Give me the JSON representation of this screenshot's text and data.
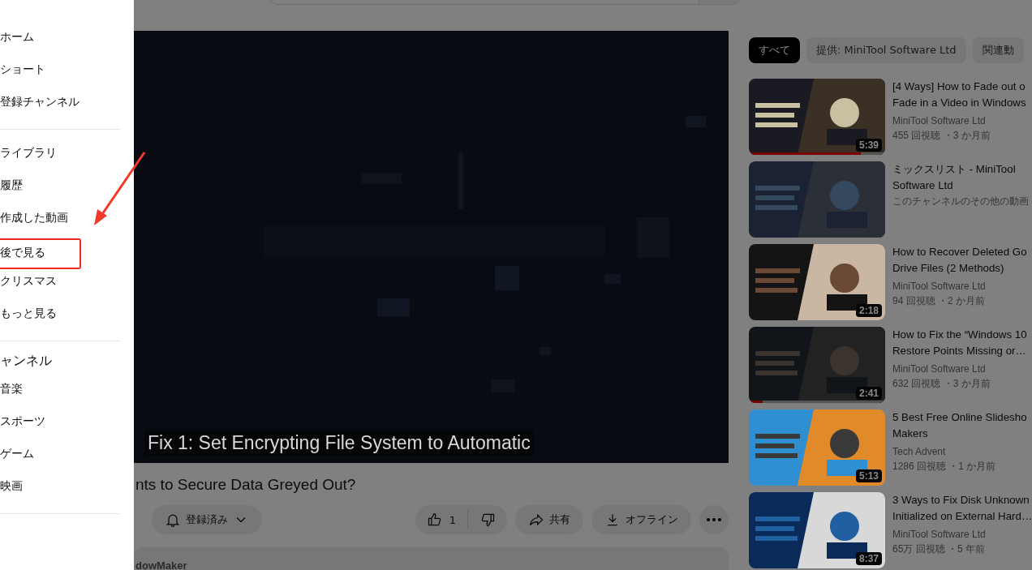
{
  "sidebar": {
    "sections": [
      {
        "items": [
          {
            "label": "ホーム",
            "highlighted": false
          },
          {
            "label": "ショート",
            "highlighted": false
          },
          {
            "label": "登録チャンネル",
            "highlighted": false
          }
        ]
      },
      {
        "items": [
          {
            "label": "ライブラリ",
            "highlighted": false
          },
          {
            "label": "履歴",
            "highlighted": false
          },
          {
            "label": "作成した動画",
            "highlighted": false
          },
          {
            "label": "後で見る",
            "highlighted": true
          },
          {
            "label": "クリスマス",
            "highlighted": false
          },
          {
            "label": "もっと見る",
            "highlighted": false
          }
        ]
      },
      {
        "heading": "ャンネル",
        "items": [
          {
            "label": "音楽",
            "highlighted": false
          },
          {
            "label": "スポーツ",
            "highlighted": false
          },
          {
            "label": "ゲーム",
            "highlighted": false
          },
          {
            "label": "映画",
            "highlighted": false
          }
        ]
      }
    ]
  },
  "player": {
    "caption": "Fix 1: Set Encrypting File System to Automatic"
  },
  "video": {
    "title": "nts to Secure Data Greyed Out?",
    "subscribe": "登録済み",
    "likes": "1",
    "share": "共有",
    "download": "オフライン",
    "description": "dowMaker"
  },
  "chips": [
    {
      "label": "すべて",
      "selected": true
    },
    {
      "label": "提供: MiniTool Software Ltd",
      "selected": false
    },
    {
      "label": "関連動",
      "selected": false
    }
  ],
  "recommendations": [
    {
      "title_lines": [
        "[4 Ways] How to Fade out o",
        "Fade in a Video in Windows"
      ],
      "channel": "MiniTool Software Ltd",
      "meta": "455 回視聴 ・3 か月前",
      "duration": "5:39",
      "level": 0.82
    },
    {
      "title_lines": [
        "ミックスリスト - MiniTool",
        "Software Ltd"
      ],
      "meta": "このチャンネルのその他の動画"
    },
    {
      "title_lines": [
        "How to Recover Deleted Go",
        "Drive Files (2 Methods)"
      ],
      "channel": "MiniTool Software Ltd",
      "meta": "94 回視聴 ・2 か月前",
      "duration": "2:18"
    },
    {
      "title_lines": [
        "How to Fix the “Windows 10",
        "Restore Points Missing or…"
      ],
      "channel": "MiniTool Software Ltd",
      "meta": "632 回視聴 ・3 か月前",
      "duration": "2:41",
      "level": 0.1
    },
    {
      "title_lines": [
        "5 Best Free Online Slidesho",
        "Makers"
      ],
      "channel": "Tech Advent",
      "meta": "1286 回視聴 ・1 か月前",
      "duration": "5:13"
    },
    {
      "title_lines": [
        "3 Ways to Fix Disk Unknown",
        "Initialized on External Hard…"
      ],
      "channel": "MiniTool Software Ltd",
      "meta": "65万 回視聴 ・5 年前",
      "duration": "8:37"
    }
  ]
}
